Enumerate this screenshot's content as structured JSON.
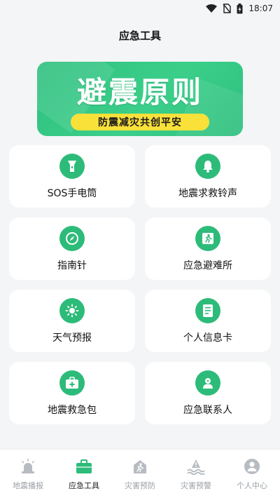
{
  "status_bar": {
    "time": "18:07"
  },
  "header": {
    "title": "应急工具"
  },
  "banner": {
    "title": "避震原则",
    "subtitle": "防震减灾共创平安"
  },
  "tools": [
    {
      "label": "SOS手电筒",
      "icon": "flashlight-icon"
    },
    {
      "label": "地震求救铃声",
      "icon": "bell-icon"
    },
    {
      "label": "指南针",
      "icon": "compass-icon"
    },
    {
      "label": "应急避难所",
      "icon": "running-exit-icon"
    },
    {
      "label": "天气预报",
      "icon": "sun-icon"
    },
    {
      "label": "个人信息卡",
      "icon": "id-card-icon"
    },
    {
      "label": "地震救急包",
      "icon": "first-aid-kit-icon"
    },
    {
      "label": "应急联系人",
      "icon": "contact-person-icon"
    }
  ],
  "tabs": [
    {
      "label": "地震播报",
      "icon": "alarm-siren-icon",
      "active": false
    },
    {
      "label": "应急工具",
      "icon": "toolbox-icon",
      "active": true
    },
    {
      "label": "灾害预防",
      "icon": "shield-run-icon",
      "active": false
    },
    {
      "label": "灾害预警",
      "icon": "warning-wave-icon",
      "active": false
    },
    {
      "label": "个人中心",
      "icon": "user-icon",
      "active": false
    }
  ],
  "colors": {
    "accent": "#2dbb79",
    "banner_pill": "#f9e13a",
    "tab_inactive": "#9aa0a6"
  }
}
